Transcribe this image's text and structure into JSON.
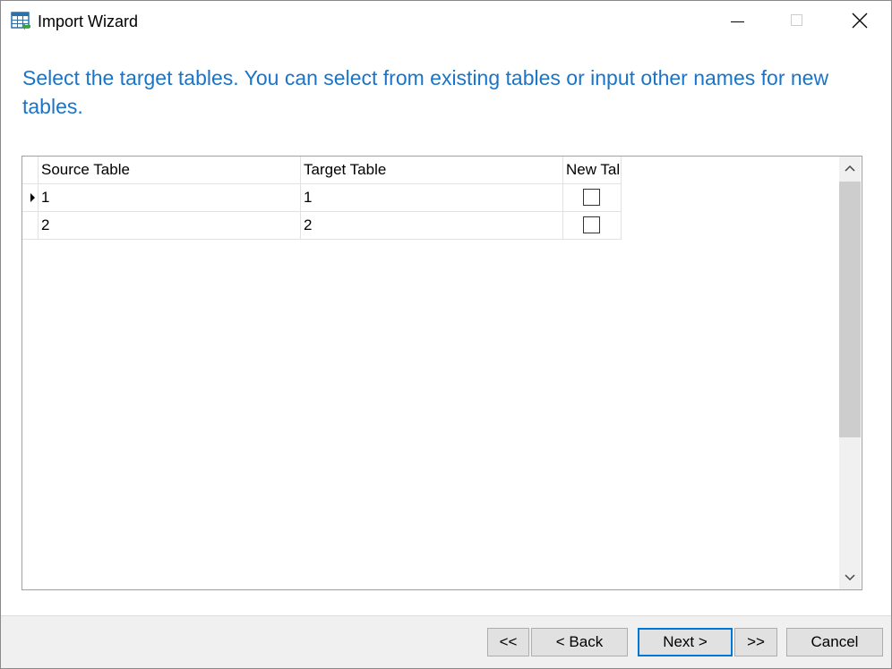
{
  "window": {
    "title": "Import Wizard",
    "app_icon": "table-import-icon"
  },
  "instruction": "Select the target tables. You can select from existing tables or input other names for new tables.",
  "grid": {
    "columns": [
      "Source Table",
      "Target Table",
      "New Tal"
    ],
    "rows": [
      {
        "source": "1",
        "target": "1",
        "new_table": false,
        "current": true
      },
      {
        "source": "2",
        "target": "2",
        "new_table": false,
        "current": false
      }
    ]
  },
  "buttons": {
    "first": "<<",
    "back": "< Back",
    "next": "Next >",
    "last": ">>",
    "cancel": "Cancel"
  },
  "colors": {
    "accent": "#1a74c8",
    "focus_border": "#0078d7",
    "footer_bg": "#f0f0f0"
  }
}
